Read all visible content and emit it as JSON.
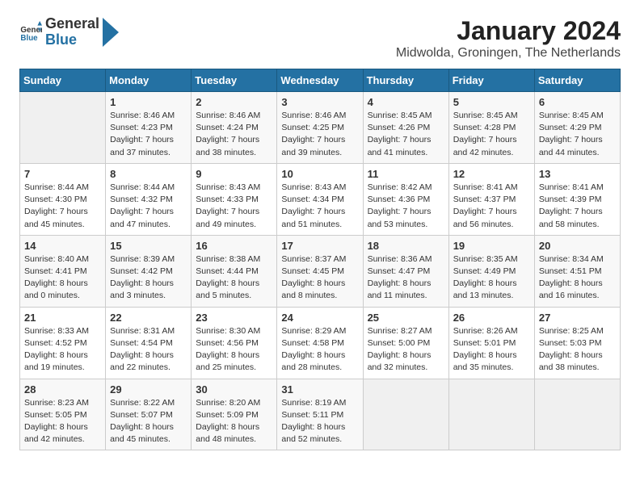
{
  "header": {
    "logo_general": "General",
    "logo_blue": "Blue",
    "title": "January 2024",
    "subtitle": "Midwolda, Groningen, The Netherlands"
  },
  "calendar": {
    "days_of_week": [
      "Sunday",
      "Monday",
      "Tuesday",
      "Wednesday",
      "Thursday",
      "Friday",
      "Saturday"
    ],
    "weeks": [
      [
        {
          "day": "",
          "info": ""
        },
        {
          "day": "1",
          "info": "Sunrise: 8:46 AM\nSunset: 4:23 PM\nDaylight: 7 hours\nand 37 minutes."
        },
        {
          "day": "2",
          "info": "Sunrise: 8:46 AM\nSunset: 4:24 PM\nDaylight: 7 hours\nand 38 minutes."
        },
        {
          "day": "3",
          "info": "Sunrise: 8:46 AM\nSunset: 4:25 PM\nDaylight: 7 hours\nand 39 minutes."
        },
        {
          "day": "4",
          "info": "Sunrise: 8:45 AM\nSunset: 4:26 PM\nDaylight: 7 hours\nand 41 minutes."
        },
        {
          "day": "5",
          "info": "Sunrise: 8:45 AM\nSunset: 4:28 PM\nDaylight: 7 hours\nand 42 minutes."
        },
        {
          "day": "6",
          "info": "Sunrise: 8:45 AM\nSunset: 4:29 PM\nDaylight: 7 hours\nand 44 minutes."
        }
      ],
      [
        {
          "day": "7",
          "info": "Sunrise: 8:44 AM\nSunset: 4:30 PM\nDaylight: 7 hours\nand 45 minutes."
        },
        {
          "day": "8",
          "info": "Sunrise: 8:44 AM\nSunset: 4:32 PM\nDaylight: 7 hours\nand 47 minutes."
        },
        {
          "day": "9",
          "info": "Sunrise: 8:43 AM\nSunset: 4:33 PM\nDaylight: 7 hours\nand 49 minutes."
        },
        {
          "day": "10",
          "info": "Sunrise: 8:43 AM\nSunset: 4:34 PM\nDaylight: 7 hours\nand 51 minutes."
        },
        {
          "day": "11",
          "info": "Sunrise: 8:42 AM\nSunset: 4:36 PM\nDaylight: 7 hours\nand 53 minutes."
        },
        {
          "day": "12",
          "info": "Sunrise: 8:41 AM\nSunset: 4:37 PM\nDaylight: 7 hours\nand 56 minutes."
        },
        {
          "day": "13",
          "info": "Sunrise: 8:41 AM\nSunset: 4:39 PM\nDaylight: 7 hours\nand 58 minutes."
        }
      ],
      [
        {
          "day": "14",
          "info": "Sunrise: 8:40 AM\nSunset: 4:41 PM\nDaylight: 8 hours\nand 0 minutes."
        },
        {
          "day": "15",
          "info": "Sunrise: 8:39 AM\nSunset: 4:42 PM\nDaylight: 8 hours\nand 3 minutes."
        },
        {
          "day": "16",
          "info": "Sunrise: 8:38 AM\nSunset: 4:44 PM\nDaylight: 8 hours\nand 5 minutes."
        },
        {
          "day": "17",
          "info": "Sunrise: 8:37 AM\nSunset: 4:45 PM\nDaylight: 8 hours\nand 8 minutes."
        },
        {
          "day": "18",
          "info": "Sunrise: 8:36 AM\nSunset: 4:47 PM\nDaylight: 8 hours\nand 11 minutes."
        },
        {
          "day": "19",
          "info": "Sunrise: 8:35 AM\nSunset: 4:49 PM\nDaylight: 8 hours\nand 13 minutes."
        },
        {
          "day": "20",
          "info": "Sunrise: 8:34 AM\nSunset: 4:51 PM\nDaylight: 8 hours\nand 16 minutes."
        }
      ],
      [
        {
          "day": "21",
          "info": "Sunrise: 8:33 AM\nSunset: 4:52 PM\nDaylight: 8 hours\nand 19 minutes."
        },
        {
          "day": "22",
          "info": "Sunrise: 8:31 AM\nSunset: 4:54 PM\nDaylight: 8 hours\nand 22 minutes."
        },
        {
          "day": "23",
          "info": "Sunrise: 8:30 AM\nSunset: 4:56 PM\nDaylight: 8 hours\nand 25 minutes."
        },
        {
          "day": "24",
          "info": "Sunrise: 8:29 AM\nSunset: 4:58 PM\nDaylight: 8 hours\nand 28 minutes."
        },
        {
          "day": "25",
          "info": "Sunrise: 8:27 AM\nSunset: 5:00 PM\nDaylight: 8 hours\nand 32 minutes."
        },
        {
          "day": "26",
          "info": "Sunrise: 8:26 AM\nSunset: 5:01 PM\nDaylight: 8 hours\nand 35 minutes."
        },
        {
          "day": "27",
          "info": "Sunrise: 8:25 AM\nSunset: 5:03 PM\nDaylight: 8 hours\nand 38 minutes."
        }
      ],
      [
        {
          "day": "28",
          "info": "Sunrise: 8:23 AM\nSunset: 5:05 PM\nDaylight: 8 hours\nand 42 minutes."
        },
        {
          "day": "29",
          "info": "Sunrise: 8:22 AM\nSunset: 5:07 PM\nDaylight: 8 hours\nand 45 minutes."
        },
        {
          "day": "30",
          "info": "Sunrise: 8:20 AM\nSunset: 5:09 PM\nDaylight: 8 hours\nand 48 minutes."
        },
        {
          "day": "31",
          "info": "Sunrise: 8:19 AM\nSunset: 5:11 PM\nDaylight: 8 hours\nand 52 minutes."
        },
        {
          "day": "",
          "info": ""
        },
        {
          "day": "",
          "info": ""
        },
        {
          "day": "",
          "info": ""
        }
      ]
    ]
  }
}
